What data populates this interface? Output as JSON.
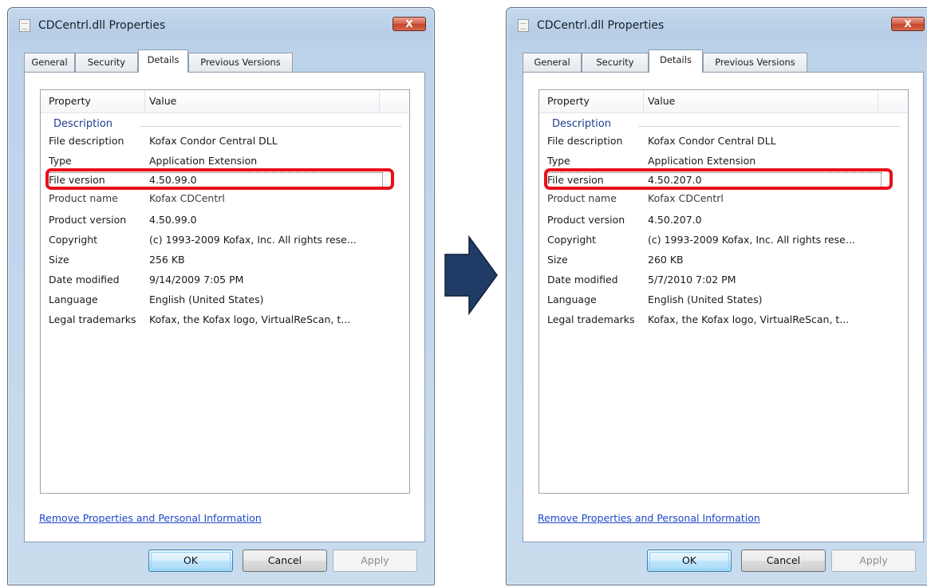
{
  "dialogs": [
    {
      "title": "CDCentrl.dll Properties",
      "close_label": "X",
      "tabs": [
        "General",
        "Security",
        "Details",
        "Previous Versions"
      ],
      "active_tab": "Details",
      "columns": [
        "Property",
        "Value"
      ],
      "group": "Description",
      "rows": [
        {
          "property": "File description",
          "value": "Kofax Condor Central DLL"
        },
        {
          "property": "Type",
          "value": "Application Extension"
        },
        {
          "property": "File version",
          "value": "4.50.99.0"
        },
        {
          "property": "Product name",
          "value": "Kofax CDCentrl"
        },
        {
          "property": "Product version",
          "value": "4.50.99.0"
        },
        {
          "property": "Copyright",
          "value": "(c) 1993-2009 Kofax, Inc. All rights rese..."
        },
        {
          "property": "Size",
          "value": "256 KB"
        },
        {
          "property": "Date modified",
          "value": "9/14/2009 7:05 PM"
        },
        {
          "property": "Language",
          "value": "English (United States)"
        },
        {
          "property": "Legal trademarks",
          "value": "Kofax, the Kofax logo, VirtualReScan, t..."
        }
      ],
      "link": "Remove Properties and Personal Information",
      "buttons": {
        "ok": "OK",
        "cancel": "Cancel",
        "apply": "Apply"
      }
    },
    {
      "title": "CDCentrl.dll Properties",
      "close_label": "X",
      "tabs": [
        "General",
        "Security",
        "Details",
        "Previous Versions"
      ],
      "active_tab": "Details",
      "columns": [
        "Property",
        "Value"
      ],
      "group": "Description",
      "rows": [
        {
          "property": "File description",
          "value": "Kofax Condor Central DLL"
        },
        {
          "property": "Type",
          "value": "Application Extension"
        },
        {
          "property": "File version",
          "value": "4.50.207.0"
        },
        {
          "property": "Product name",
          "value": "Kofax CDCentrl"
        },
        {
          "property": "Product version",
          "value": "4.50.207.0"
        },
        {
          "property": "Copyright",
          "value": "(c) 1993-2009 Kofax, Inc. All rights rese..."
        },
        {
          "property": "Size",
          "value": "260 KB"
        },
        {
          "property": "Date modified",
          "value": "5/7/2010 7:02 PM"
        },
        {
          "property": "Language",
          "value": "English (United States)"
        },
        {
          "property": "Legal trademarks",
          "value": "Kofax, the Kofax logo, VirtualReScan, t..."
        }
      ],
      "link": "Remove Properties and Personal Information",
      "buttons": {
        "ok": "OK",
        "cancel": "Cancel",
        "apply": "Apply"
      }
    }
  ],
  "colors": {
    "highlight": "#e8101a",
    "arrow_fill": "#1f3b66",
    "link": "#1d47c7",
    "group_heading": "#1e3d91"
  },
  "icons": {
    "title": "document-icon",
    "close": "close-icon",
    "transition": "right-arrow-icon"
  }
}
